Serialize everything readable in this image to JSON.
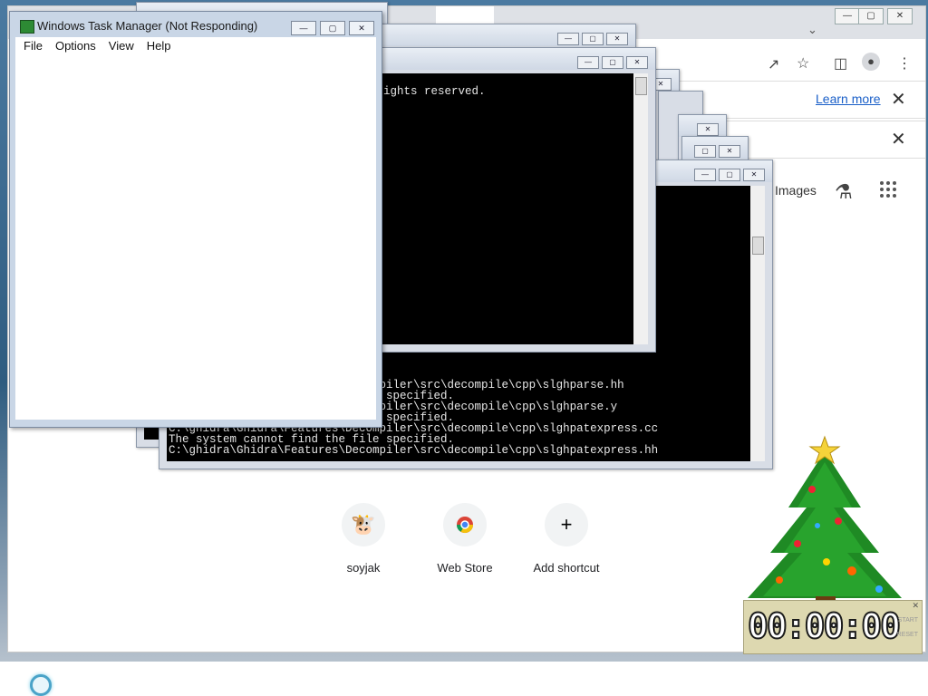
{
  "taskmgr": {
    "title": "Windows Task Manager (Not Responding)",
    "menu": [
      "File",
      "Options",
      "View",
      "Help"
    ]
  },
  "chrome": {
    "learn_more": "Learn more",
    "images": "Images",
    "shortcuts": [
      {
        "label": "soyjak",
        "icon": "soyjak-favicon"
      },
      {
        "label": "Web Store",
        "icon": "chrome-webstore-icon"
      },
      {
        "label": "Add shortcut",
        "icon": "plus-icon"
      }
    ]
  },
  "cmd_front": {
    "lines": [
      "C:\\ghidra\\Ghidra\\Features\\Decompiler\\src\\decompile\\cpp\\slghparse.hh",
      "The system cannot find the file specified.",
      "C:\\ghidra\\Ghidra\\Features\\Decompiler\\src\\decompile\\cpp\\slghparse.y",
      "The system cannot find the file specified.",
      "C:\\ghidra\\Ghidra\\Features\\Decompiler\\src\\decompile\\cpp\\slghpatexpress.cc",
      "The system cannot find the file specified.",
      "C:\\ghidra\\Ghidra\\Features\\Decompiler\\src\\decompile\\cpp\\slghpatexpress.hh"
    ]
  },
  "cmd_mid": {
    "line": "(c) Microsoft Corporation. All rights reserved."
  },
  "timer": {
    "display": "00:00:00",
    "side_top": "START",
    "side_bottom": "RESET"
  },
  "colors": {
    "console_bg": "#000000",
    "console_fg": "#e6e6e6",
    "link": "#1a5fc8"
  }
}
